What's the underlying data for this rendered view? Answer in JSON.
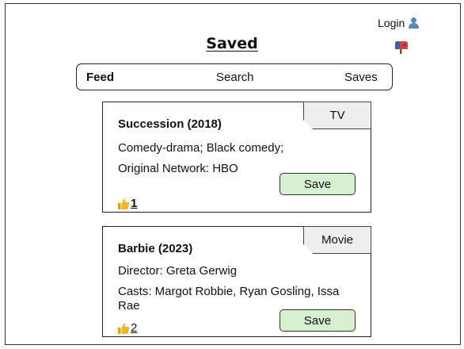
{
  "header": {
    "login_label": "Login",
    "page_title": "Saved"
  },
  "nav": {
    "feed": "Feed",
    "search": "Search",
    "saves": "Saves"
  },
  "cards": [
    {
      "title": "Succession (2018)",
      "tag": "TV",
      "lines": [
        "Comedy-drama; Black comedy;",
        "Original Network: HBO"
      ],
      "save_label": "Save",
      "likes": "1"
    },
    {
      "title": "Barbie (2023)",
      "tag": "Movie",
      "lines": [
        "Director: Greta Gerwig",
        "Casts: Margot Robbie, Ryan Gosling, Issa Rae"
      ],
      "save_label": "Save",
      "likes": "2"
    }
  ],
  "colors": {
    "save_button": "#d6efd0",
    "tag_background": "#efefef",
    "thumb": "#f2b722",
    "user_icon": "#5d87b8",
    "mailbox": "#d64242"
  },
  "icons": {
    "login": "person-icon",
    "mail": "mailbox-icon",
    "likes": "thumbs-up-icon"
  }
}
